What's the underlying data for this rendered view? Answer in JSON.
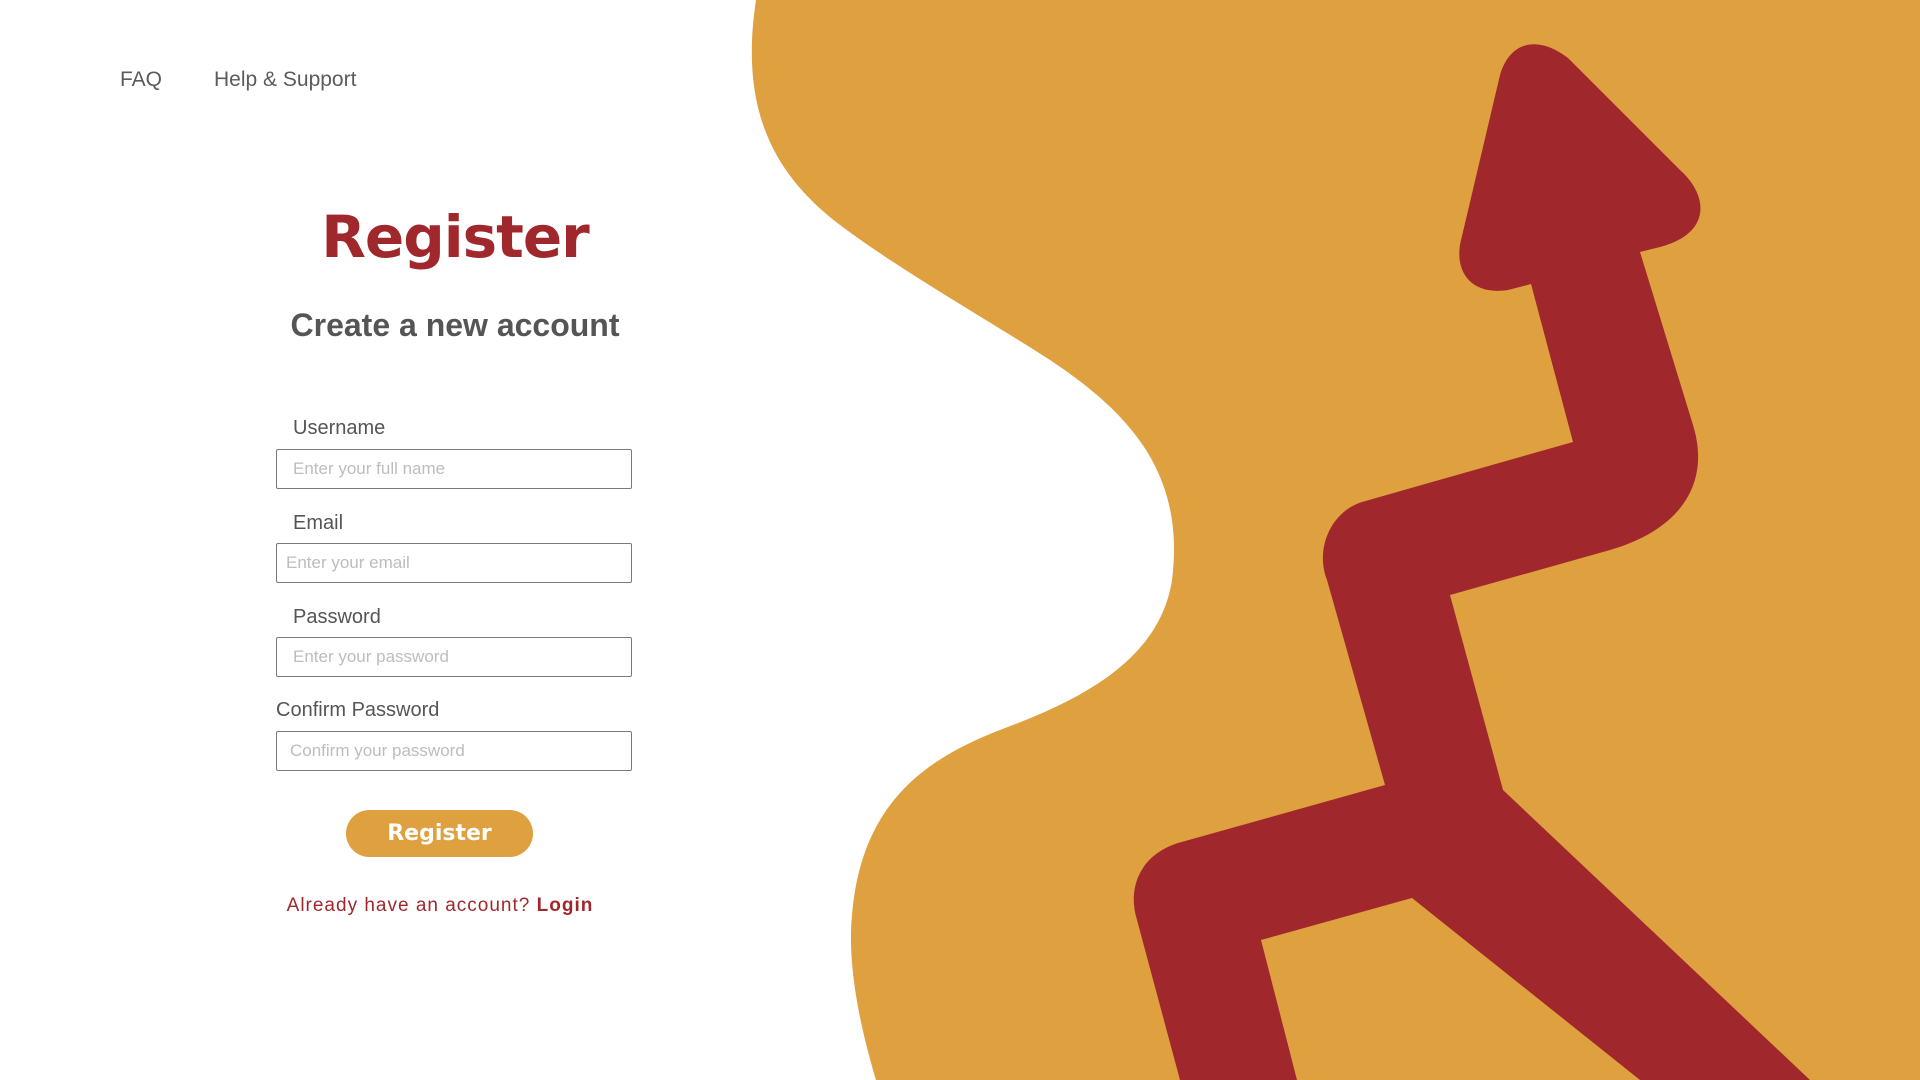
{
  "nav": {
    "faq_label": "FAQ",
    "help_label": "Help & Support"
  },
  "form": {
    "title": "Register",
    "subtitle": "Create a new account",
    "username": {
      "label": "Username",
      "placeholder": "Enter your full name",
      "value": ""
    },
    "email": {
      "label": "Email",
      "placeholder": "Enter your email",
      "value": ""
    },
    "password": {
      "label": "Password",
      "placeholder": "Enter your password",
      "value": ""
    },
    "confirm_password": {
      "label": "Confirm Password",
      "placeholder": "Confirm your password",
      "value": ""
    },
    "submit_label": "Register",
    "login_prompt": "Already have an account?",
    "login_link": "Login"
  },
  "theme": {
    "accent": "#a0282d",
    "brand_orange": "#dfa03f",
    "text_gray": "#555555"
  },
  "illustration": {
    "name": "growth-arrow-illustration"
  }
}
